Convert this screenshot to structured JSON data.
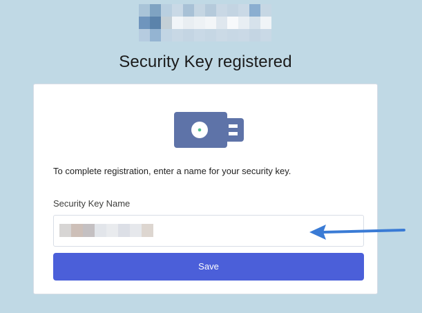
{
  "header": {
    "title": "Security Key registered"
  },
  "logo": {
    "mosaic_colors": [
      "#a9c4d8",
      "#7fa3c2",
      "#b9cfe0",
      "#c9d9e6",
      "#a8c1d6",
      "#c5d6e3",
      "#b5cadb",
      "#c9d8e5",
      "#c3d4e2",
      "#cad9e6",
      "#8aaed0",
      "#c6d7e4",
      "#6f95bd",
      "#5b83ab",
      "#c3cfd6",
      "#f1f5f8",
      "#e9eef2",
      "#eef2f5",
      "#f3f6f8",
      "#dfe7ee",
      "#f7f9fb",
      "#e8eef3",
      "#d6e2eb",
      "#f0f4f7",
      "#b6cce0",
      "#94b4d2",
      "#c2d5e4",
      "#c8d8e5",
      "#c4d5e3",
      "#c9d9e6",
      "#c6d7e4",
      "#cbdae6",
      "#c8d8e5",
      "#cad9e6",
      "#c4d5e3",
      "#c9d9e6"
    ]
  },
  "card": {
    "instruction": "To complete registration, enter a name for your security key.",
    "field_label": "Security Key Name",
    "input_value_redacted_colors": [
      "#d7d5d4",
      "#cdbfb8",
      "#c4c0c2",
      "#e2e5ea",
      "#e9ebee",
      "#dcdfe6",
      "#e6e8ec",
      "#ddd6d0"
    ],
    "save_label": "Save"
  },
  "colors": {
    "background": "#c0d9e5",
    "button": "#4b5fd9",
    "key_body": "#5e73a8",
    "key_led": "#4fc08d",
    "arrow": "#3a7bd5"
  },
  "icons": {
    "security_key": "usb-security-key-icon",
    "arrow": "arrow-left-annotation"
  }
}
